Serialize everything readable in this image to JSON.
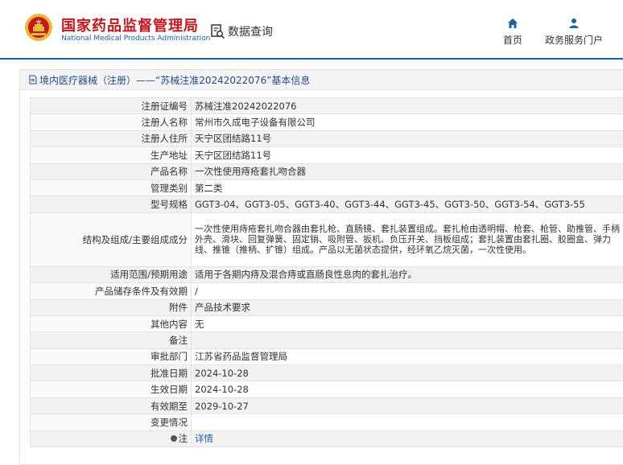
{
  "header": {
    "brand_cn": "国家药品监督管理局",
    "brand_en": "National Medical Products Administration",
    "data_query": "数据查询",
    "nav_home": "首页",
    "nav_portal": "政务服务门户"
  },
  "page": {
    "title": "境内医疗器械（注册）——“苏械注准20242022076”基本信息"
  },
  "rows": [
    {
      "label": "注册证编号",
      "value": "苏械注准20242022076"
    },
    {
      "label": "注册人名称",
      "value": "常州市久成电子设备有限公司"
    },
    {
      "label": "注册人住所",
      "value": "天宁区团结路11号"
    },
    {
      "label": "生产地址",
      "value": "天宁区团结路11号"
    },
    {
      "label": "产品名称",
      "value": "一次性使用痔疮套扎吻合器"
    },
    {
      "label": "管理类别",
      "value": "第二类"
    },
    {
      "label": "型号规格",
      "value": "GGT3-04、GGT3-05、GGT3-40、GGT3-44、GGT3-45、GGT3-50、GGT3-54、GGT3-55"
    },
    {
      "label": "结构及组成/主要组成成分",
      "value": "一次性使用痔疮套扎吻合器由套扎枪、直肠镜、套扎装置组成。套扎枪由透明帽、枪套、枪管、助推管、手柄外壳、滑块、回复弹簧、固定销、吸附管、扳机、负压开关、挡板组成；套扎装置由套扎圈、胶圈盒、弹力线、推锥（推柄、扩锥）组成。产品以无菌状态提供，经环氧乙烷灭菌，一次性使用。"
    },
    {
      "label": "适用范围/预期用途",
      "value": "适用于各期内痔及混合痔或直肠良性息肉的套扎治疗。"
    },
    {
      "label": "产品储存条件及有效期",
      "value": "/"
    },
    {
      "label": "附件",
      "value": "产品技术要求"
    },
    {
      "label": "其他内容",
      "value": "无"
    },
    {
      "label": "备注",
      "value": ""
    },
    {
      "label": "审批部门",
      "value": "江苏省药品监督管理局"
    },
    {
      "label": "批准日期",
      "value": "2024-10-28"
    },
    {
      "label": "生效日期",
      "value": "2024-10-28"
    },
    {
      "label": "有效期至",
      "value": "2029-10-27"
    },
    {
      "label": "变更情况",
      "value": ""
    },
    {
      "label": "注",
      "value": "详情"
    }
  ],
  "icons": {
    "emblem": "national-emblem-icon",
    "search_doc": "search-document-icon",
    "home": "home-icon",
    "user": "user-icon",
    "doc": "document-icon",
    "note": "note-dot-icon"
  },
  "colors": {
    "brand_red": "#c8161d",
    "brand_blue": "#1f5ea8",
    "link": "#1f5ea8"
  }
}
